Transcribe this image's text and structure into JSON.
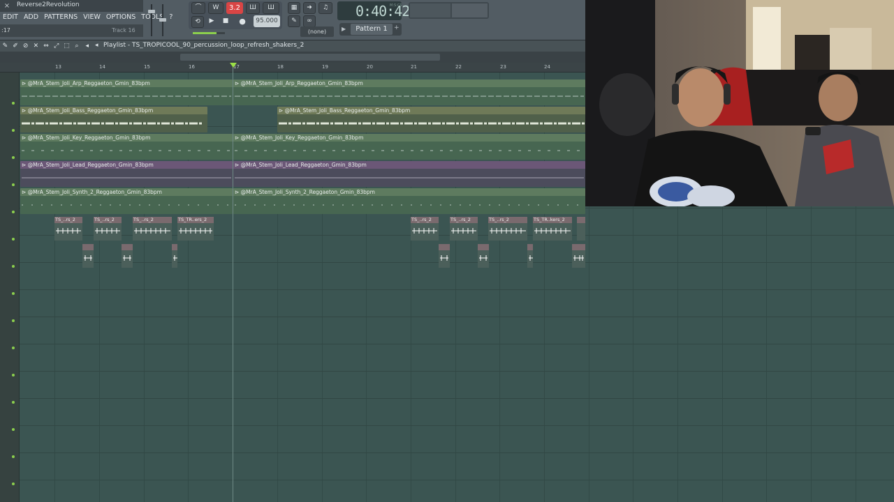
{
  "app": {
    "project_title": "Reverse2Revolution",
    "close_glyph": "×",
    "menu": [
      "EDIT",
      "ADD",
      "PATTERNS",
      "VIEW",
      "OPTIONS",
      "TOOLS",
      "?"
    ],
    "hint_left": ":17",
    "hint_right": "Track 16"
  },
  "transport": {
    "record_value": "3.2",
    "tempo": "95.000",
    "time": "0:40:42",
    "time_label": "M:S:CS",
    "snap": "(none)",
    "pattern": "Pattern 1"
  },
  "playlist": {
    "title": "Playlist - TS_TROPICOOL_90_percussion_loop_refresh_shakers_2",
    "bar_numbers": [
      "13",
      "14",
      "15",
      "16",
      "17",
      "18",
      "19",
      "20",
      "21",
      "22",
      "23",
      "24"
    ]
  },
  "clips": {
    "arp": "@MrA_Stem_Joli_Arp_Reggaeton_Gmin_83bpm",
    "bass": "@MrA_Stem_Joli_Bass_Reggaeton_Gmin_83bpm",
    "key": "@MrA_Stem_Joli_Key_Reggaeton_Gmin_83bpm",
    "lead": "@MrA_Stem_Joli_Lead_Reggaeton_Gmin_83bpm",
    "synth": "@MrA_Stem_Joli_Synth_2_Reggaeton_Gmin_83bpm",
    "perc_a": "TS_..rs_2",
    "perc_b": "TS_TR..ers_2",
    "perc_c": "TS_TR..kers_2"
  },
  "colors": {
    "accent_green": "#8ccf4d",
    "record_red": "#d94545",
    "grid_bg": "#3b5552"
  }
}
